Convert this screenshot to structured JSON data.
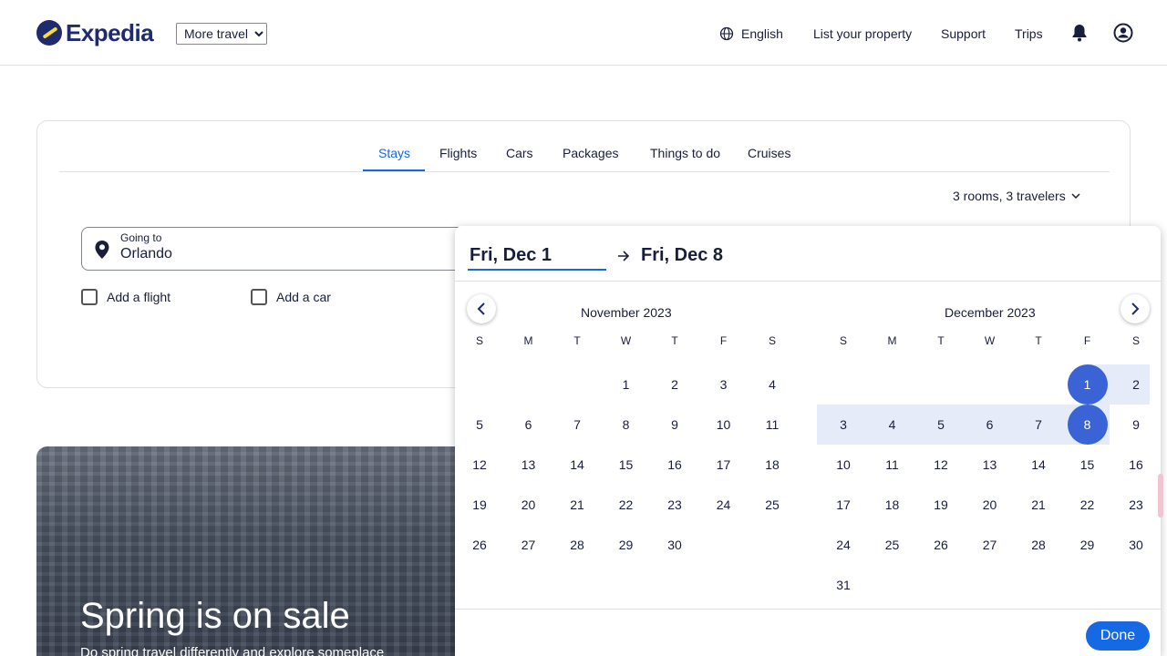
{
  "header": {
    "brand": "Expedia",
    "more_travel": "More travel",
    "language": "English",
    "list_property": "List your property",
    "support": "Support",
    "trips": "Trips"
  },
  "tabs": [
    "Stays",
    "Flights",
    "Cars",
    "Packages",
    "Things to do",
    "Cruises"
  ],
  "search": {
    "rooms": "3 rooms, 3 travelers",
    "going_label": "Going to",
    "going_value": "Orlando",
    "add_flight": "Add a flight",
    "add_car": "Add a car"
  },
  "picker": {
    "start_date": "Fri, Dec 1",
    "end_date": "Fri, Dec 8",
    "done": "Done",
    "weekdays": [
      "S",
      "M",
      "T",
      "W",
      "T",
      "F",
      "S"
    ],
    "months": [
      {
        "title": "November 2023",
        "first_weekday": 3,
        "days": 30
      },
      {
        "title": "December 2023",
        "first_weekday": 5,
        "days": 31
      }
    ],
    "selected_start": 1,
    "selected_end": 8
  },
  "promo": {
    "title": "Spring is on sale",
    "subtitle": "Do spring travel differently and explore someplace"
  },
  "colors": {
    "accent": "#1668e3",
    "brand_navy": "#1f2b6c",
    "selection": "#3a63d6",
    "range": "#e6ebfa"
  }
}
